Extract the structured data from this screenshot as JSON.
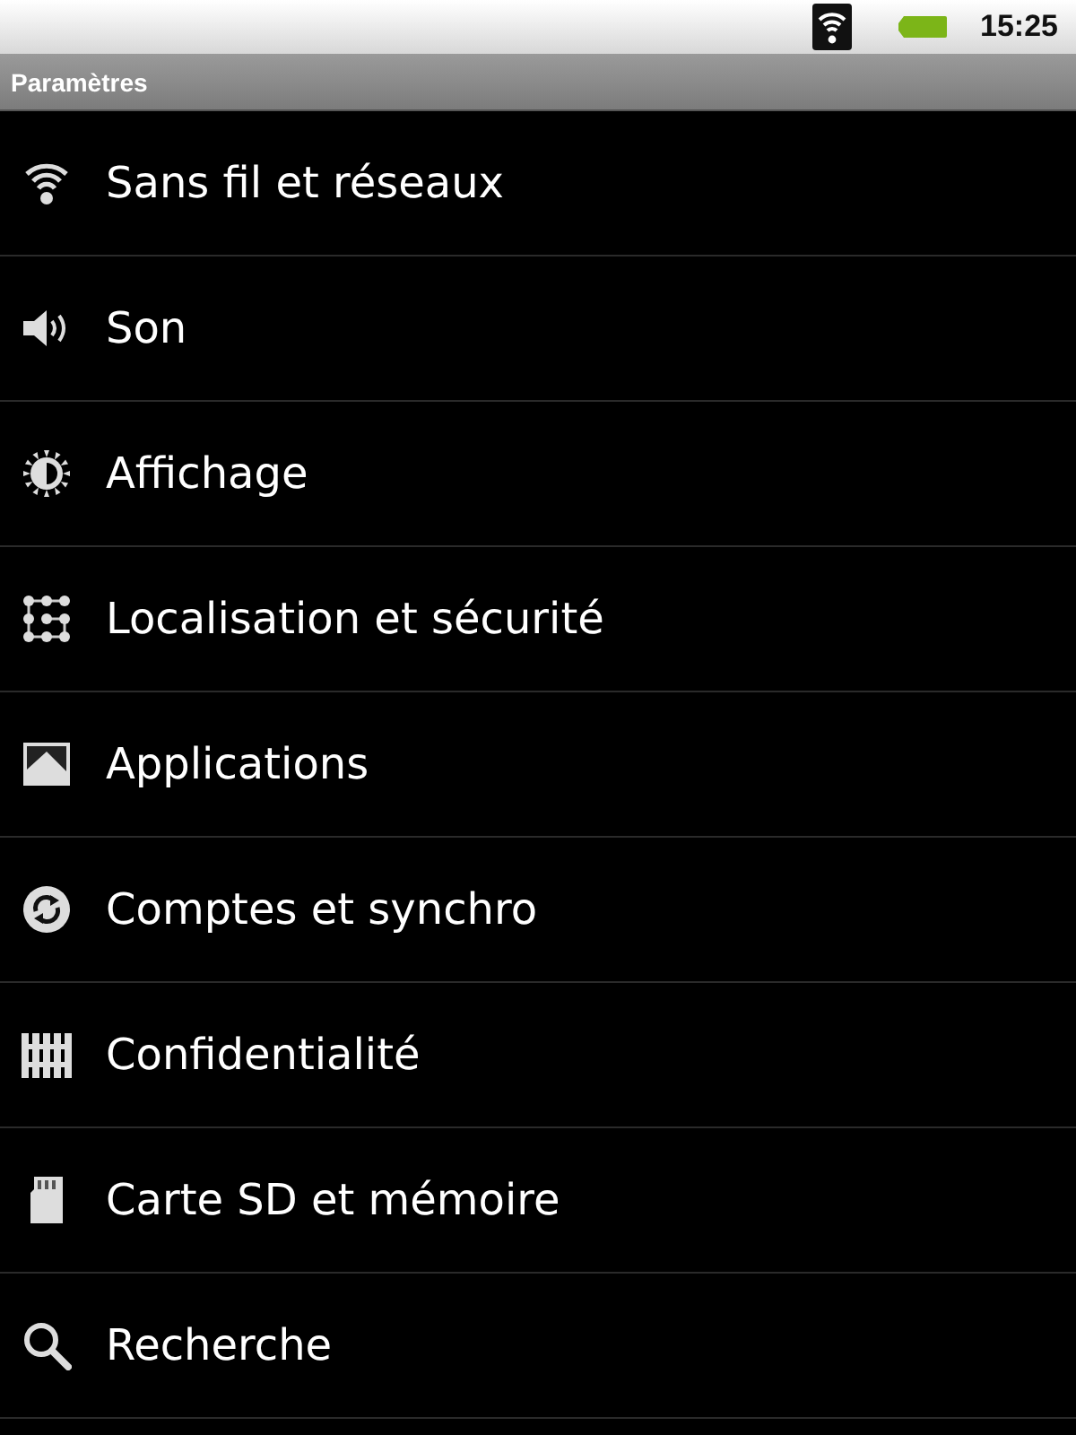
{
  "status_bar": {
    "time": "15:25"
  },
  "title_bar": {
    "title": "Paramètres"
  },
  "items": [
    {
      "kind": "wifi",
      "label": "Sans fil et réseaux"
    },
    {
      "kind": "sound",
      "label": "Son"
    },
    {
      "kind": "display",
      "label": "Affichage"
    },
    {
      "kind": "location",
      "label": "Localisation et sécurité"
    },
    {
      "kind": "apps",
      "label": "Applications"
    },
    {
      "kind": "sync",
      "label": "Comptes et synchro"
    },
    {
      "kind": "privacy",
      "label": "Confidentialité"
    },
    {
      "kind": "sdcard",
      "label": "Carte SD et mémoire"
    },
    {
      "kind": "search",
      "label": "Recherche"
    }
  ]
}
